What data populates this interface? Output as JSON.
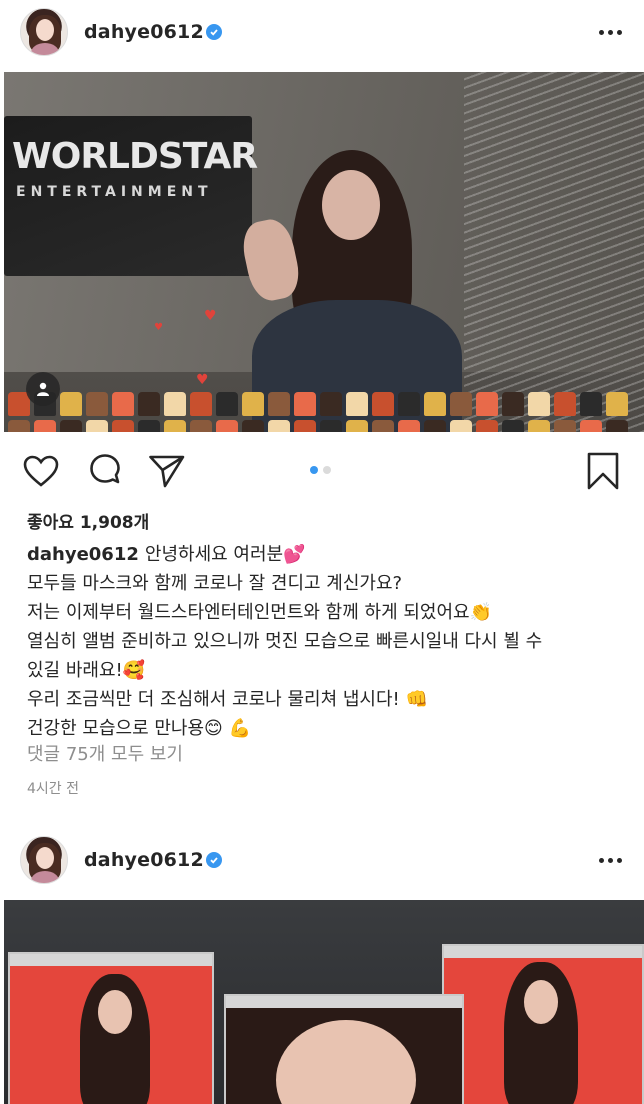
{
  "post1": {
    "username": "dahye0612",
    "likes": "좋아요 1,908개",
    "caption_user": "dahye0612",
    "caption_lines": [
      "안녕하세요 여러분💕",
      "모두들 마스크와 함께 코로나 잘 견디고 계신가요?",
      "저는 이제부터 월드스타엔터테인먼트와 함께 하게 되었어요👏",
      "열심히 앨범 준비하고 있으니까 멋진 모습으로 빠른시일내 다시 뵐 수",
      "있길 바래요!🥰",
      "우리 조금씩만 더 조심해서 코로나 물리쳐 냅시다! 👊",
      "건강한 모습으로 만나용😊 💪"
    ],
    "view_comments": "댓글 75개 모두 보기",
    "time": "4시간 전",
    "sign_line1": "WORLDSTAR",
    "sign_line2": "ENTERTAINMENT"
  },
  "post2": {
    "username": "dahye0612"
  },
  "colors": {
    "verified": "#3897f0",
    "dot_active": "#3897f0",
    "dot_inactive": "#dbdbdb",
    "text": "#262626",
    "muted": "#8e8e8e"
  }
}
